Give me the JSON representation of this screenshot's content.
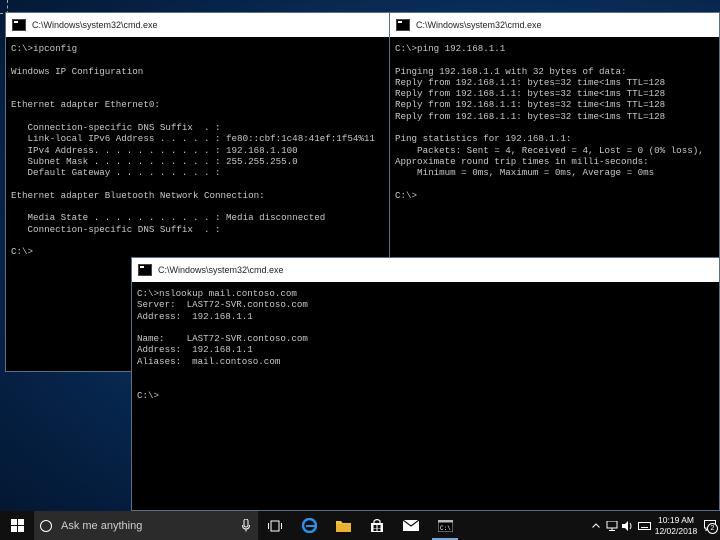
{
  "window1": {
    "title": "C:\\Windows\\system32\\cmd.exe",
    "lines": [
      "C:\\>ipconfig",
      "",
      "Windows IP Configuration",
      "",
      "",
      "Ethernet adapter Ethernet0:",
      "",
      "   Connection-specific DNS Suffix  . :",
      "   Link-local IPv6 Address . . . . . : fe80::cbf:1c48:41ef:1f54%11",
      "   IPv4 Address. . . . . . . . . . . : 192.168.1.100",
      "   Subnet Mask . . . . . . . . . . . : 255.255.255.0",
      "   Default Gateway . . . . . . . . . :",
      "",
      "Ethernet adapter Bluetooth Network Connection:",
      "",
      "   Media State . . . . . . . . . . . : Media disconnected",
      "   Connection-specific DNS Suffix  . :",
      "",
      "C:\\>"
    ]
  },
  "window2": {
    "title": "C:\\Windows\\system32\\cmd.exe",
    "lines": [
      "C:\\>ping 192.168.1.1",
      "",
      "Pinging 192.168.1.1 with 32 bytes of data:",
      "Reply from 192.168.1.1: bytes=32 time<1ms TTL=128",
      "Reply from 192.168.1.1: bytes=32 time<1ms TTL=128",
      "Reply from 192.168.1.1: bytes=32 time<1ms TTL=128",
      "Reply from 192.168.1.1: bytes=32 time<1ms TTL=128",
      "",
      "Ping statistics for 192.168.1.1:",
      "    Packets: Sent = 4, Received = 4, Lost = 0 (0% loss),",
      "Approximate round trip times in milli-seconds:",
      "    Minimum = 0ms, Maximum = 0ms, Average = 0ms",
      "",
      "C:\\>"
    ]
  },
  "window3": {
    "title": "C:\\Windows\\system32\\cmd.exe",
    "lines": [
      "C:\\>nslookup mail.contoso.com",
      "Server:  LAST72-SVR.contoso.com",
      "Address:  192.168.1.1",
      "",
      "Name:    LAST72-SVR.contoso.com",
      "Address:  192.168.1.1",
      "Aliases:  mail.contoso.com",
      "",
      "",
      "C:\\>"
    ]
  },
  "taskbar": {
    "search_placeholder": "Ask me anything",
    "time": "10:19 AM",
    "date": "12/02/2018",
    "notification_count": "2",
    "icons": [
      "windows-start-icon",
      "cortana-search-icon",
      "microphone-icon",
      "task-view-icon",
      "edge-browser-icon",
      "file-explorer-icon",
      "store-icon",
      "mail-icon",
      "cmd-icon"
    ],
    "tray_icons": [
      "chevron-up-icon",
      "network-icon",
      "speaker-icon",
      "keyboard-icon"
    ]
  },
  "colors": {
    "console_bg": "#000000",
    "console_text": "#c8c8c8",
    "taskbar_bg": "#101010",
    "active_indicator": "#7aa7d8"
  }
}
